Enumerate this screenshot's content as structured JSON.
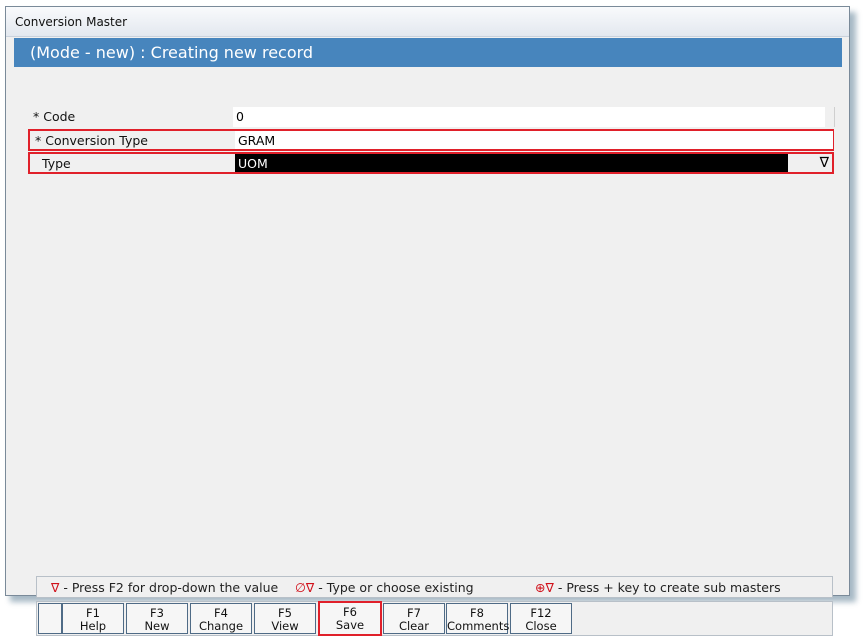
{
  "window": {
    "title": "Conversion Master"
  },
  "header": {
    "title": "(Mode - new) : Creating new record"
  },
  "form": {
    "code": {
      "label": "* Code",
      "value": "0"
    },
    "conversion_type": {
      "label": "* Conversion Type",
      "value": "GRAM"
    },
    "type": {
      "label": "Type",
      "value": "UOM",
      "dropdown_icon": "∇"
    }
  },
  "legend": {
    "dropdown": {
      "symbol": "∇",
      "text": "- Press F2 for drop-down the value"
    },
    "type_choose": {
      "symbol": "∅∇",
      "text": "- Type or choose existing"
    },
    "create_sub": {
      "symbol": "⊕∇",
      "text": "- Press + key to create sub masters"
    }
  },
  "fkeys": [
    {
      "key": "F1",
      "label": "Help"
    },
    {
      "key": "F3",
      "label": "New"
    },
    {
      "key": "F4",
      "label": "Change"
    },
    {
      "key": "F5",
      "label": "View"
    },
    {
      "key": "F6",
      "label": "Save"
    },
    {
      "key": "F7",
      "label": "Clear"
    },
    {
      "key": "F8",
      "label": "Comments"
    },
    {
      "key": "F12",
      "label": "Close"
    }
  ],
  "colors": {
    "header_bg": "#4785bd",
    "highlight_border": "#e0202a",
    "selected_field_bg": "#000000"
  }
}
